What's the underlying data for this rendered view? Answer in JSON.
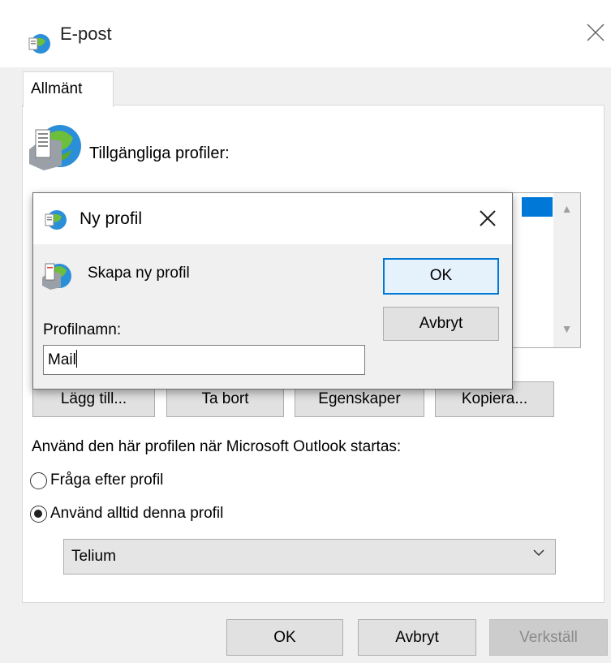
{
  "window": {
    "title": "E-post",
    "icon": "mail-globe-icon",
    "close_icon": "close-icon"
  },
  "tabs": [
    {
      "label": "Allmänt",
      "active": true
    }
  ],
  "profiles": {
    "label": "Tillgängliga profiler:",
    "icon": "mail-profile-icon"
  },
  "profile_buttons": {
    "add": "Lägg till...",
    "remove": "Ta bort",
    "properties": "Egenskaper",
    "copy": "Kopiera..."
  },
  "startup": {
    "label": "Använd den här profilen när Microsoft Outlook startas:",
    "options": [
      {
        "label": "Fråga efter profil",
        "checked": false
      },
      {
        "label": "Använd alltid denna profil",
        "checked": true
      }
    ],
    "selected_profile": "Telium"
  },
  "dialog_buttons": {
    "ok": "OK",
    "cancel": "Avbryt",
    "apply": "Verkställ"
  },
  "new_profile_dialog": {
    "title": "Ny profil",
    "create_label": "Skapa ny profil",
    "name_label": "Profilnamn:",
    "name_value": "Mail",
    "ok": "OK",
    "cancel": "Avbryt"
  },
  "colors": {
    "accent": "#0078d7",
    "window_bg": "#f0f0f0",
    "button_bg": "#e1e1e1"
  }
}
